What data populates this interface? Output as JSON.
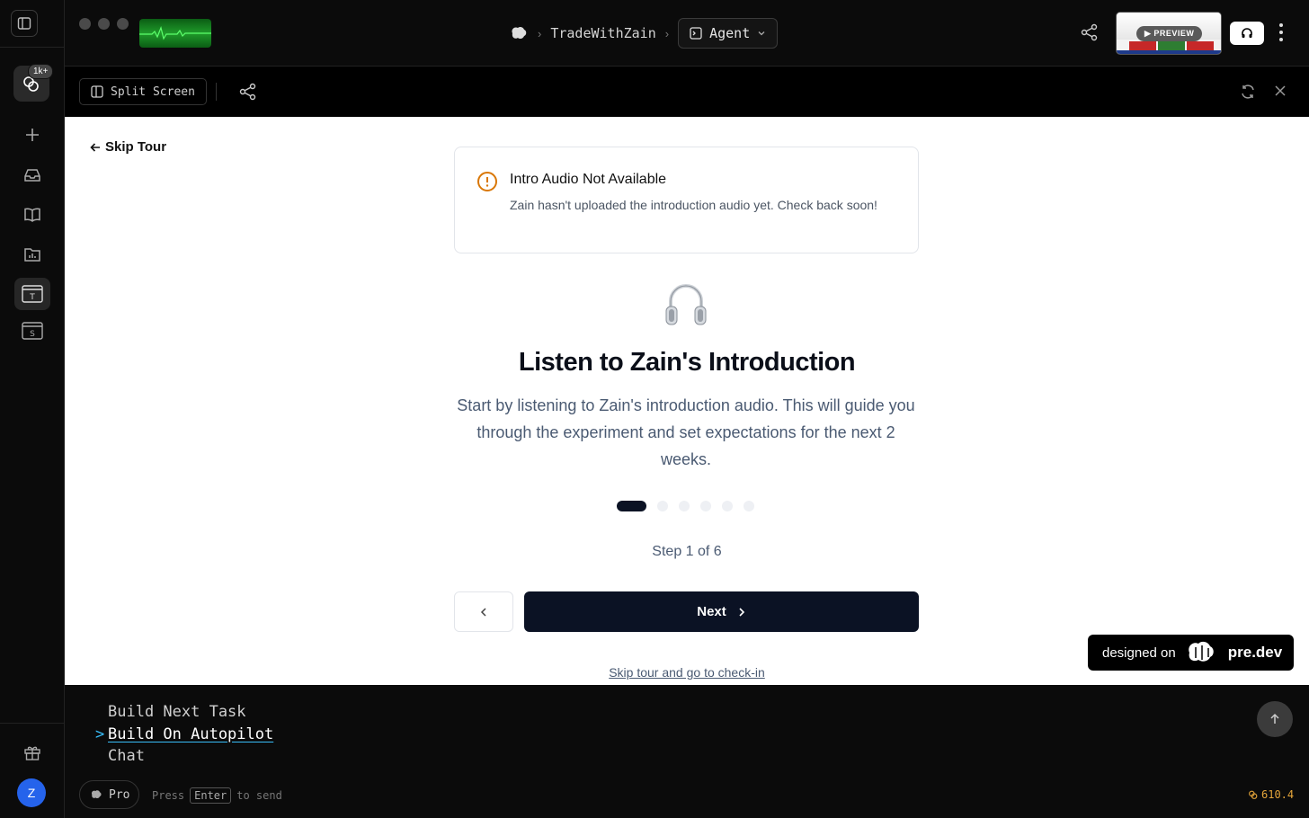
{
  "rail": {
    "credits_badge": "1k+",
    "avatar_initial": "Z"
  },
  "header": {
    "crumb_project": "TradeWithZain",
    "mode_label": "Agent",
    "preview_label": "PREVIEW"
  },
  "toolbar": {
    "split_label": "Split Screen"
  },
  "tour": {
    "skip_label": "Skip Tour",
    "alert_title": "Intro Audio Not Available",
    "alert_desc": "Zain hasn't uploaded the introduction audio yet. Check back soon!",
    "title": "Listen to Zain's Introduction",
    "description": "Start by listening to Zain's introduction audio. This will guide you through the experiment and set expectations for the next 2 weeks.",
    "step_label": "Step 1 of 6",
    "current_step": 1,
    "total_steps": 6,
    "next_label": "Next",
    "skip_link": "Skip tour and go to check-in"
  },
  "badge": {
    "designed_on": "designed on",
    "brand": "pre.dev"
  },
  "prompt": {
    "options": [
      "Build Next Task",
      "Build On Autopilot",
      "Chat"
    ],
    "selected_index": 1,
    "plan_label": "Pro",
    "hint_press": "Press",
    "hint_key": "Enter",
    "hint_send": "to send",
    "cost": "610.4"
  },
  "colors": {
    "accent": "#0b1224",
    "warning": "#d97706",
    "cost": "#e4a53a",
    "avatar": "#2563eb",
    "caret": "#38bdf8"
  },
  "icons": [
    "sidebar-toggle-icon",
    "coins-icon",
    "plus-icon",
    "inbox-icon",
    "book-icon",
    "folder-chart-icon",
    "template-t-icon",
    "template-s-icon",
    "gift-icon",
    "brain-logo-icon",
    "terminal-icon",
    "chevron-down-icon",
    "share-icon",
    "headset-icon",
    "more-vertical-icon",
    "columns-icon",
    "refresh-icon",
    "close-icon",
    "arrow-left-icon",
    "warning-circle-icon",
    "headphones-icon",
    "chevron-left-icon",
    "chevron-right-icon",
    "arrow-up-icon"
  ]
}
